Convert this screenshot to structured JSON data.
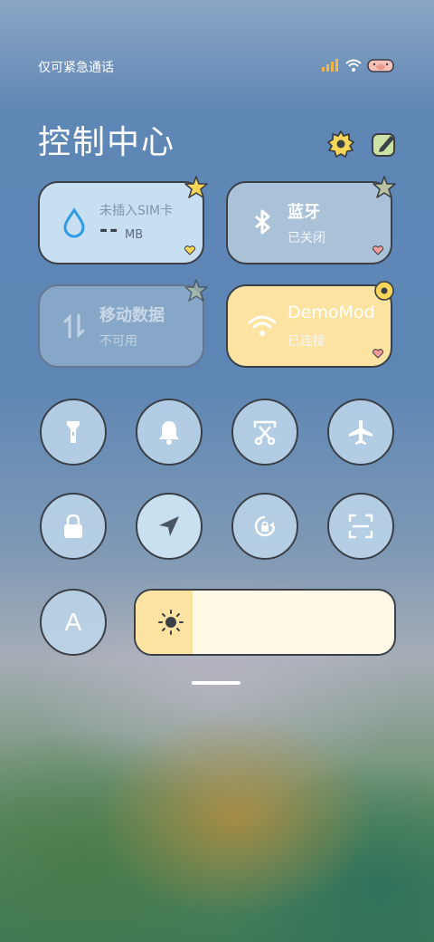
{
  "status_bar": {
    "carrier_text": "仅可紧急通话",
    "icons": [
      "signal-icon",
      "wifi-icon",
      "pig-icon"
    ]
  },
  "header": {
    "title": "控制中心",
    "settings_icon": "gear-icon",
    "edit_icon": "edit-icon"
  },
  "tiles": {
    "data_usage": {
      "label": "未插入SIM卡",
      "value": "--",
      "unit": "MB",
      "icon": "water-drop-icon"
    },
    "bluetooth": {
      "label": "蓝牙",
      "status": "已关闭",
      "icon": "bluetooth-icon"
    },
    "mobile_data": {
      "label": "移动数据",
      "status": "不可用",
      "icon": "mobile-data-icon"
    },
    "wifi": {
      "label": "DemoMod",
      "status": "已连接",
      "icon": "wifi-icon"
    }
  },
  "toggles": [
    {
      "icon": "flashlight-icon"
    },
    {
      "icon": "bell-icon"
    },
    {
      "icon": "screenshot-icon"
    },
    {
      "icon": "airplane-icon"
    },
    {
      "icon": "lock-icon"
    },
    {
      "icon": "location-icon"
    },
    {
      "icon": "rotation-lock-icon"
    },
    {
      "icon": "scan-icon"
    }
  ],
  "auto_brightness": {
    "label": "A"
  },
  "brightness": {
    "level": 0.22
  },
  "colors": {
    "tile_blue": "#c7dff0",
    "tile_blue_off": "#a9c2d8",
    "tile_yellow": "#fde3a1",
    "accent_blue": "#2f9be6"
  }
}
